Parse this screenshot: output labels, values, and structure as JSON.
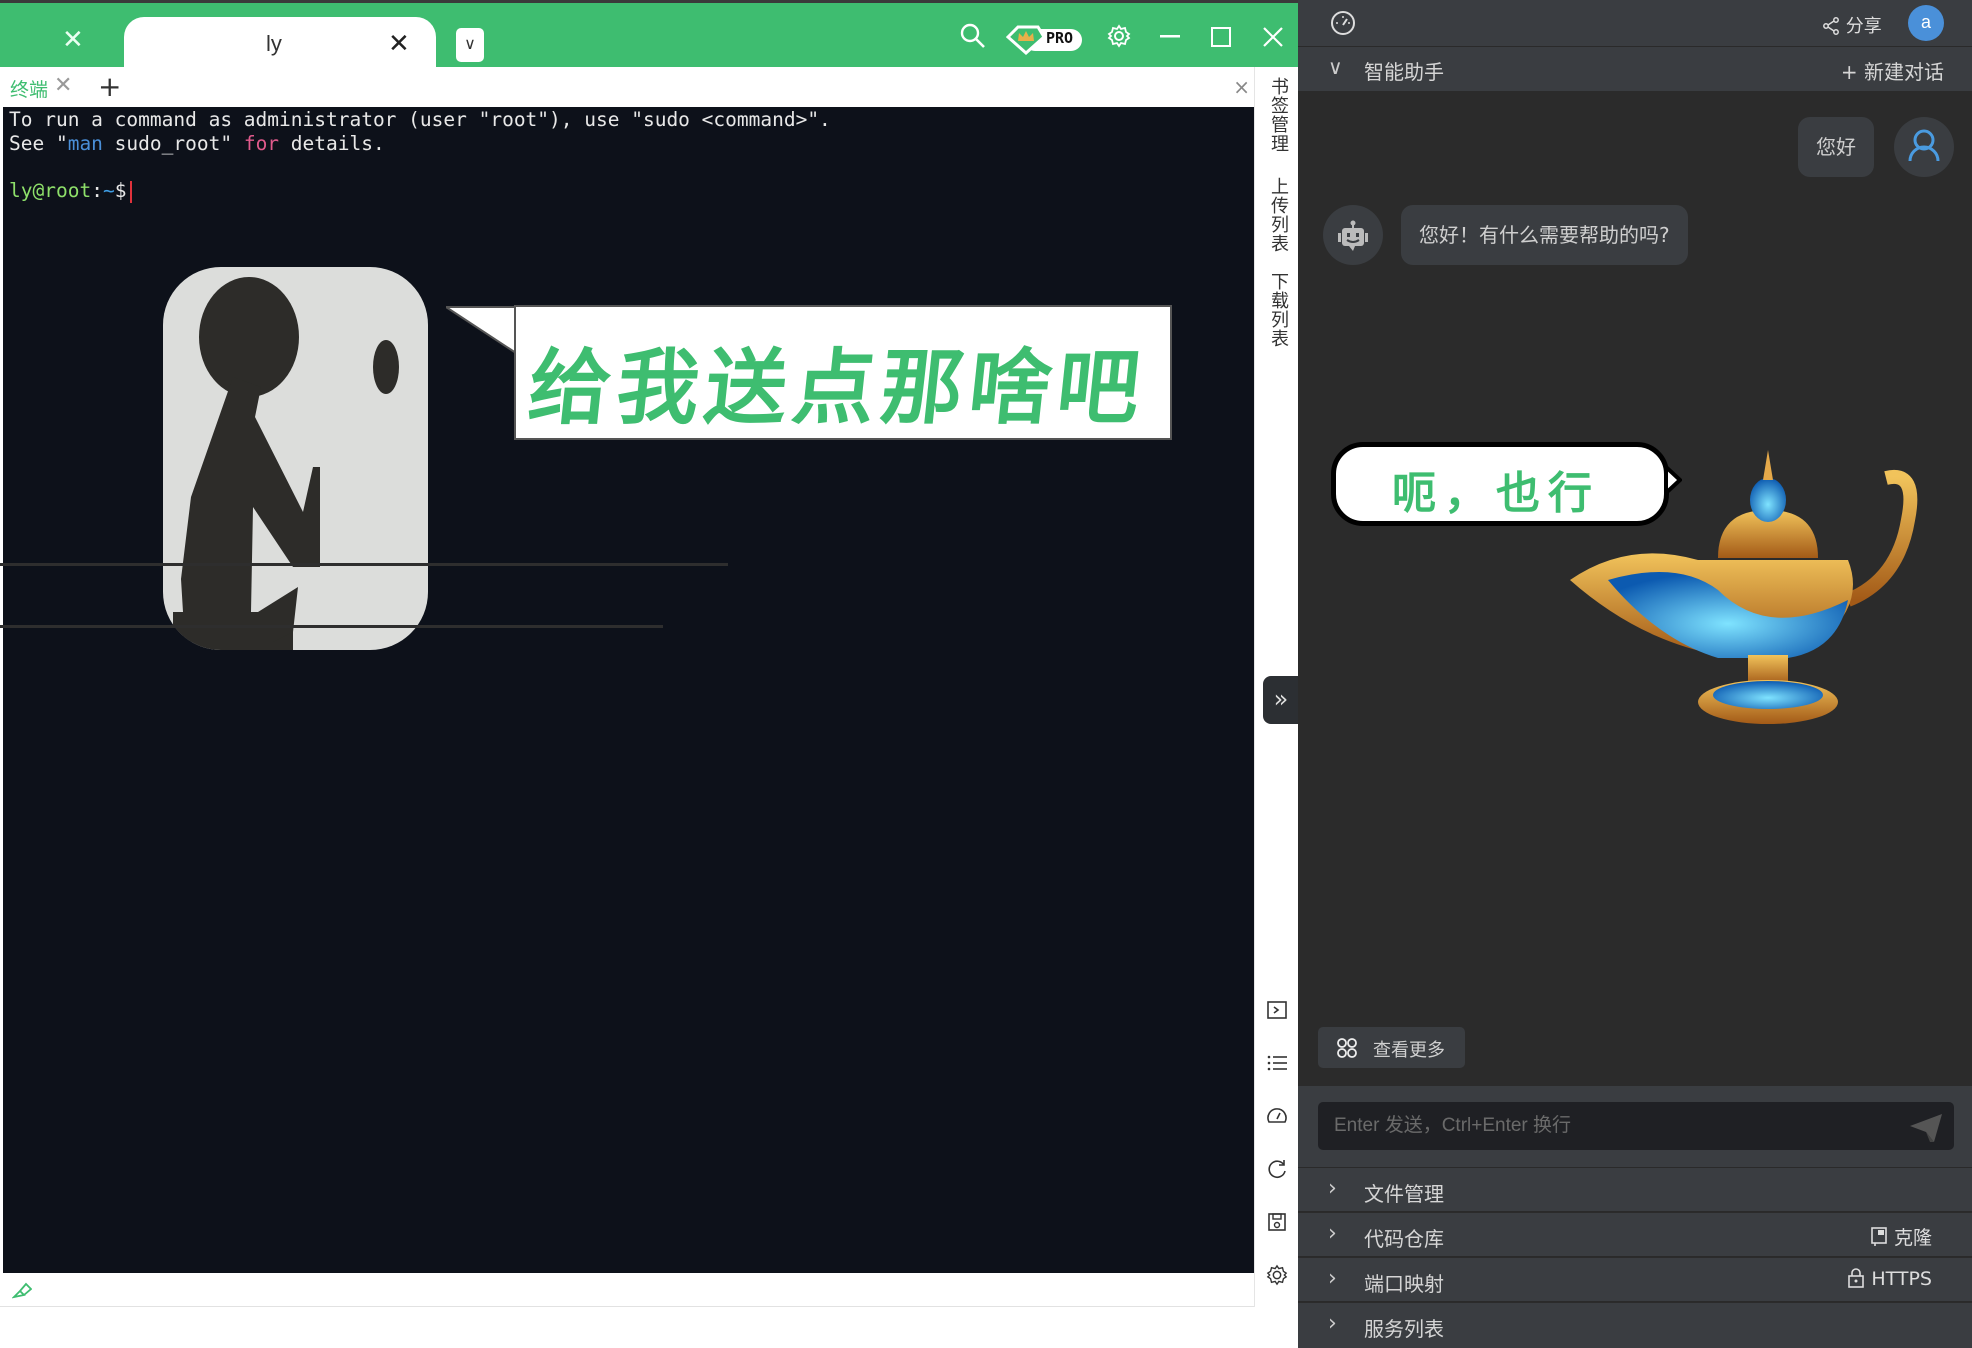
{
  "titlebar": {
    "tabs": [
      {
        "label": "",
        "active": false
      },
      {
        "label": "ly",
        "active": true
      }
    ],
    "icons": [
      "search-icon",
      "pro-badge",
      "gear-icon",
      "minimize-icon",
      "maximize-icon",
      "close-icon"
    ],
    "pro_label": "PRO",
    "accent_color": "#3ebd70"
  },
  "subbar": {
    "terminal_tab": "终端",
    "add_label": "+",
    "close_label": "×"
  },
  "terminal": {
    "lines": [
      "To run a command as administrator (user \"root\"), use \"sudo <command>\".",
      "See \"man sudo_root\" for details."
    ],
    "line2_parts": [
      "See \"",
      "man",
      " sudo_root\" ",
      "for",
      " details."
    ],
    "prompt_user": "ly@root",
    "prompt_sep": ":",
    "prompt_path": "~",
    "prompt_char": "$",
    "meme_caption": "给我送点那啥吧"
  },
  "side_panel": {
    "tabs": [
      "书签管理",
      "上传列表",
      "下载列表"
    ],
    "collapse_label": "»",
    "bottom_icons": [
      "terminal-icon",
      "list-icon",
      "dashboard-icon",
      "refresh-icon",
      "save-icon",
      "settings-icon"
    ]
  },
  "right_panel": {
    "share_label": "分享",
    "avatar_letter": "a",
    "assistant_title": "智能助手",
    "new_chat_label": "+ 新建对话",
    "messages": [
      {
        "role": "user",
        "text": "您好"
      },
      {
        "role": "assistant",
        "text": "您好！有什么需要帮助的吗?"
      }
    ],
    "meme_caption": "呃，也行",
    "more_label": "查看更多",
    "input_placeholder": "Enter 发送，Ctrl+Enter 换行",
    "sections": [
      {
        "label": "文件管理",
        "action": ""
      },
      {
        "label": "代码仓库",
        "action": "克隆",
        "action_icon": "repo-icon"
      },
      {
        "label": "端口映射",
        "action": "HTTPS",
        "action_icon": "lock-icon"
      },
      {
        "label": "服务列表",
        "action": ""
      }
    ]
  }
}
